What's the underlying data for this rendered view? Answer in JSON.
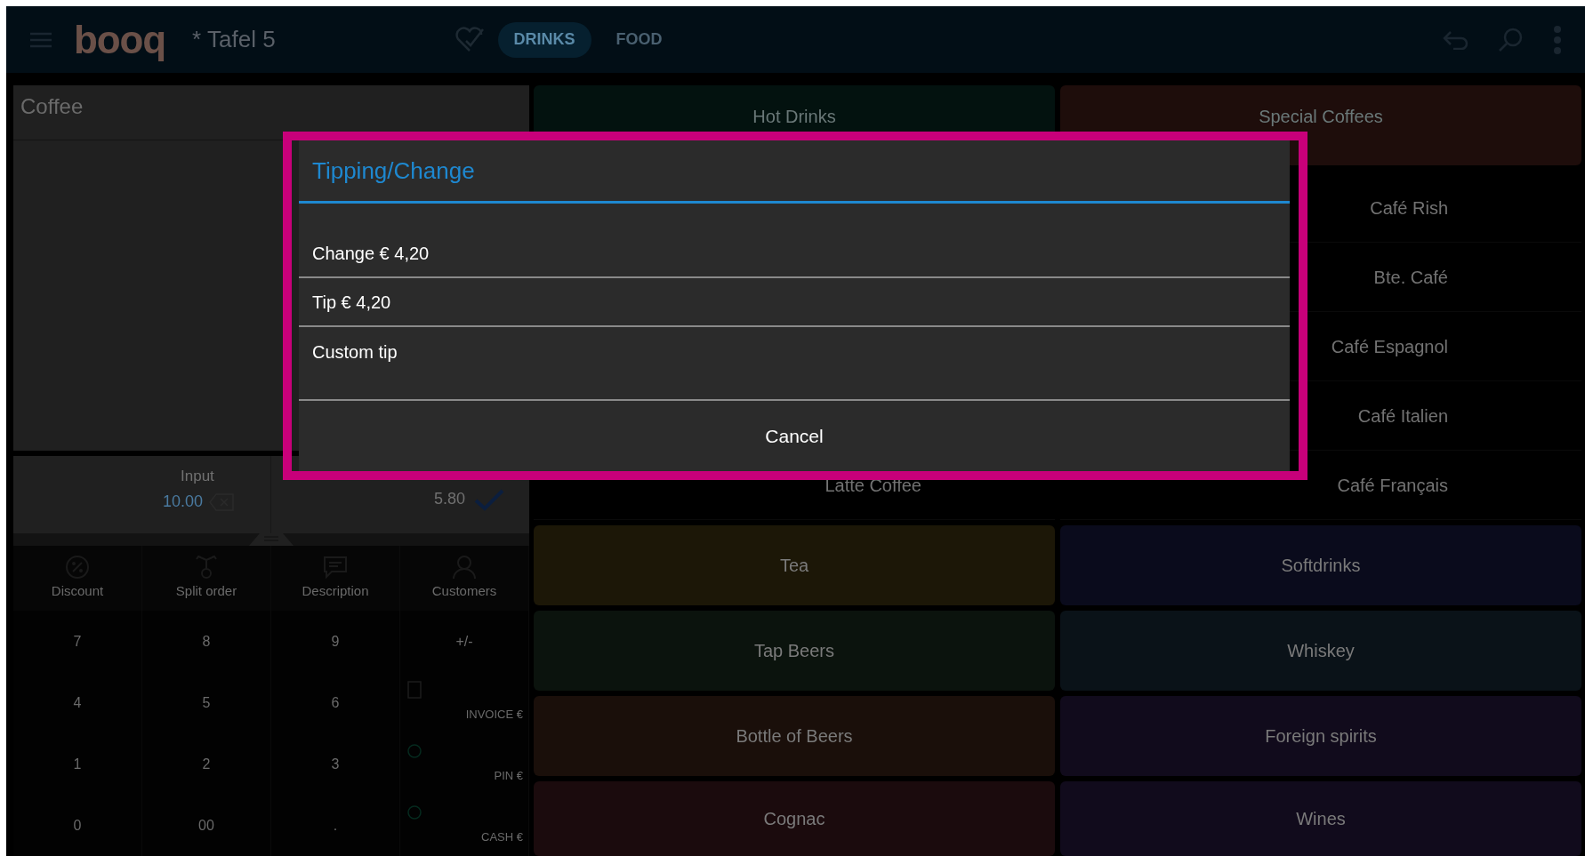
{
  "top_bar": {
    "logo": "booq",
    "title": "* Tafel 5",
    "tabs": [
      {
        "label": "DRINKS",
        "selected": true
      },
      {
        "label": "FOOD",
        "selected": false
      }
    ]
  },
  "order": {
    "category": "Coffee"
  },
  "input_panel": {
    "label": "Input",
    "value": "10.00",
    "total": "5.80"
  },
  "actions": [
    {
      "label": "Discount"
    },
    {
      "label": "Split order"
    },
    {
      "label": "Description"
    },
    {
      "label": "Customers"
    }
  ],
  "keypad": [
    {
      "label": "7",
      "kind": "digit"
    },
    {
      "label": "8",
      "kind": "digit"
    },
    {
      "label": "9",
      "kind": "digit"
    },
    {
      "label": "+/-",
      "kind": "digit"
    },
    {
      "label": "4",
      "kind": "digit"
    },
    {
      "label": "5",
      "kind": "digit"
    },
    {
      "label": "6",
      "kind": "digit"
    },
    {
      "label": "INVOICE €",
      "kind": "invoice"
    },
    {
      "label": "1",
      "kind": "digit"
    },
    {
      "label": "2",
      "kind": "digit"
    },
    {
      "label": "3",
      "kind": "digit"
    },
    {
      "label": "PIN €",
      "kind": "pin"
    },
    {
      "label": "0",
      "kind": "digit"
    },
    {
      "label": "00",
      "kind": "digit"
    },
    {
      "label": ".",
      "kind": "digit"
    },
    {
      "label": "CASH €",
      "kind": "cash"
    }
  ],
  "menu_columns": [
    {
      "header": {
        "label": "Hot Drinks",
        "color": "#03120f"
      },
      "items": [
        "Latte Coffee"
      ]
    },
    {
      "header": {
        "label": "Special Coffees",
        "color": "#1e0d0b"
      },
      "items": [
        "Café Rish",
        "Bte. Café",
        "Café Espagnol",
        "Café Italien",
        "Café Français"
      ]
    }
  ],
  "tiles": [
    {
      "label": "Tea",
      "color": "#1c1707"
    },
    {
      "label": "Softdrinks",
      "color": "#0a0b1c"
    },
    {
      "label": "Tap Beers",
      "color": "#0b130d"
    },
    {
      "label": "Whiskey",
      "color": "#0a1218"
    },
    {
      "label": "Bottle of Beers",
      "color": "#1a0f0a"
    },
    {
      "label": "Foreign spirits",
      "color": "#110b1c"
    },
    {
      "label": "Cognac",
      "color": "#1b0b0d"
    },
    {
      "label": "Wines",
      "color": "#110b1c"
    }
  ],
  "dialog": {
    "title": "Tipping/Change",
    "options": [
      "Change € 4,20",
      "Tip € 4,20",
      "Custom tip"
    ],
    "cancel": "Cancel"
  }
}
